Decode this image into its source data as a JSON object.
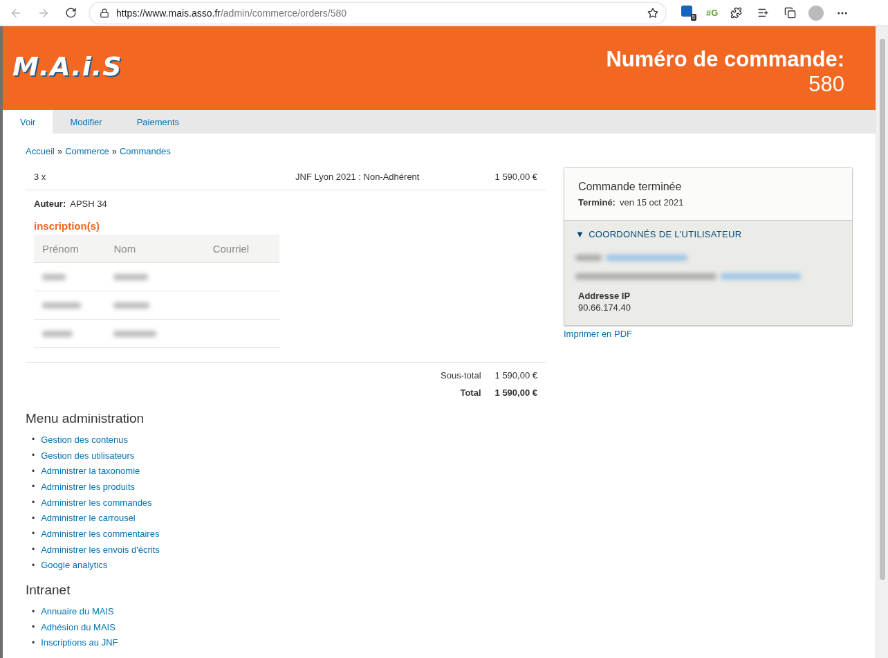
{
  "browser": {
    "url_host": "https://www.mais.asso.fr",
    "url_path": "/admin/commerce/orders/580",
    "profile_badge": "5",
    "extension_label": "#G"
  },
  "header": {
    "logo": "M.A.i.S",
    "title": "Numéro de commande:",
    "number": "580"
  },
  "tabs": [
    {
      "label": "Voir",
      "selected": true
    },
    {
      "label": "Modifier",
      "selected": false
    },
    {
      "label": "Paiements",
      "selected": false
    }
  ],
  "breadcrumb": {
    "separator": "»",
    "items": [
      "Accueil",
      "Commerce",
      "Commandes"
    ]
  },
  "line_item": {
    "quantity": "3 x",
    "title": "JNF Lyon 2021 : Non-Adhérent",
    "price": "1 590,00 €"
  },
  "author": {
    "label": "Auteur:",
    "value": "APSH 34"
  },
  "inscriptions": {
    "title": "inscription(s)",
    "columns": [
      "Prénom",
      "Nom",
      "Courriel"
    ],
    "rows": [
      {
        "redacted": true
      },
      {
        "redacted": true
      },
      {
        "redacted": true
      }
    ]
  },
  "totals": [
    {
      "label": "Sous-total",
      "value": "1 590,00 €",
      "bold": false
    },
    {
      "label": "Total",
      "value": "1 590,00 €",
      "bold": true
    }
  ],
  "status_card": {
    "title": "Commande terminée",
    "completed_label": "Terminé:",
    "completed_date": "ven 15 oct 2021",
    "section": {
      "toggle": "▼",
      "title": "COORDONNÉS DE L'UTILISATEUR",
      "expanded": true,
      "redacted": true,
      "ip_label": "Addresse IP",
      "ip_value": "90.66.174.40"
    }
  },
  "print_link": "Imprimer en PDF",
  "list_marker": "•",
  "menus": [
    {
      "title": "Menu administration",
      "links": [
        "Gestion des contenus",
        "Gestion des utilisateurs",
        "Administrer la taxonomie",
        "Administrer les produits",
        "Administrer les commandes",
        "Administrer le carrousel",
        "Administrer les commentaires",
        "Administrer les envois d'écrits",
        "Google analytics"
      ]
    },
    {
      "title": "Intranet",
      "links": [
        "Annuaire du MAIS",
        "Adhésion du MAIS",
        "Inscriptions au JNF"
      ]
    }
  ]
}
